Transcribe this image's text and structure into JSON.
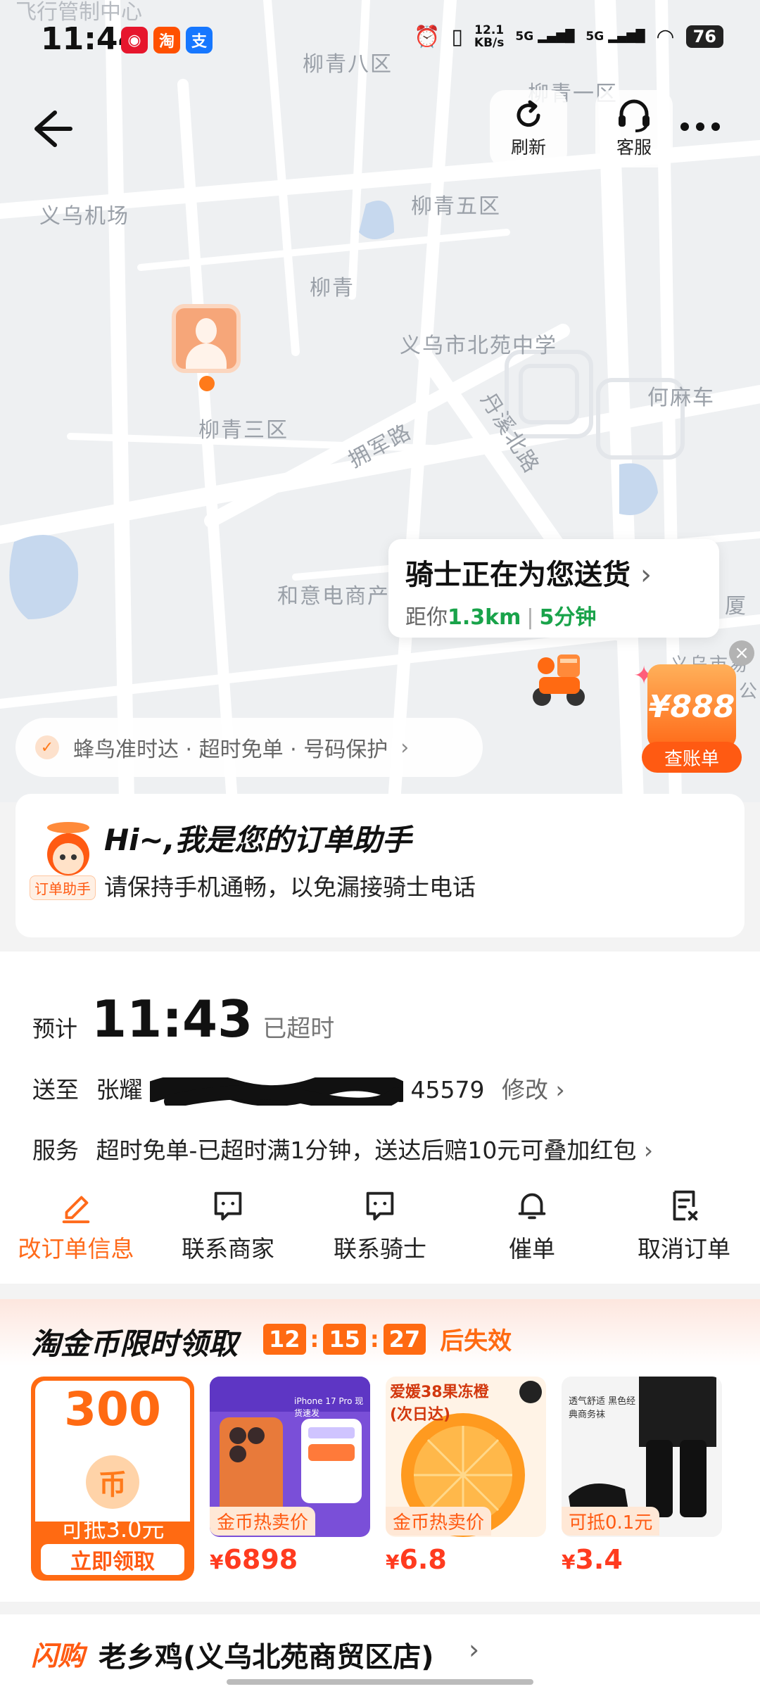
{
  "status_bar": {
    "time": "11:44",
    "carrier_overlay": "飞行管制中心",
    "net_speed_top": "12.1",
    "net_speed_bottom": "KB/s",
    "sig1": "5G",
    "sig2": "5G",
    "battery": "76",
    "app_icons": [
      "weibo-icon",
      "taobao-icon",
      "alipay-icon"
    ]
  },
  "top_bar": {
    "refresh_label": "刷新",
    "service_label": "客服"
  },
  "map": {
    "labels": [
      "柳青八区",
      "柳青一区",
      "义乌机场",
      "柳青五区",
      "柳青",
      "义乌市北苑中学",
      "何麻车",
      "柳青三区",
      "拥军路",
      "丹溪北路",
      "和意电商产",
      "厦",
      "义乌市易",
      "公"
    ]
  },
  "rider_card": {
    "title": "骑士正在为您送货",
    "distance_prefix": "距你",
    "distance": "1.3km",
    "eta": "5分钟"
  },
  "promo": {
    "amount": "¥888",
    "button": "查账单"
  },
  "guarantee": {
    "text": "蜂鸟准时达 · 超时免单 · 号码保护"
  },
  "assistant": {
    "tag": "订单助手",
    "heading": "Hi~,我是您的订单助手",
    "message": "请保持手机通畅，以免漏接骑士电话"
  },
  "order": {
    "eta_label": "预计",
    "eta_time": "11:43",
    "eta_status": "已超时",
    "deliver_label": "送至",
    "deliver_prefix": "张耀",
    "deliver_suffix": "45579",
    "edit_label": "修改",
    "service_label": "服务",
    "service_text": "超时免单-已超时满1分钟，送达后赔10元可叠加红包",
    "actions": [
      "改订单信息",
      "联系商家",
      "联系骑士",
      "催单",
      "取消订单"
    ]
  },
  "coins": {
    "title": "淘金币限时领取",
    "timer": [
      "12",
      "15",
      "27"
    ],
    "expire": "后失效",
    "coupon": {
      "amount": "300",
      "deduct": "可抵3.0元",
      "claim": "立即领取"
    },
    "products": [
      {
        "badge": "金币热卖价",
        "price": "6898",
        "caption": "iPhone 17 Pro 现货速发"
      },
      {
        "badge": "金币热卖价",
        "price": "6.8",
        "caption": "爱媛38果冻橙 (次日达)"
      },
      {
        "badge": "可抵0.1元",
        "price": "3.4",
        "caption": "透气舒适 黑色经典商务袜"
      }
    ]
  },
  "shop": {
    "brand": "闪购",
    "name": "老乡鸡(义乌北苑商贸区店)"
  },
  "colors": {
    "accent": "#ff6a12",
    "green": "#19a34a"
  }
}
